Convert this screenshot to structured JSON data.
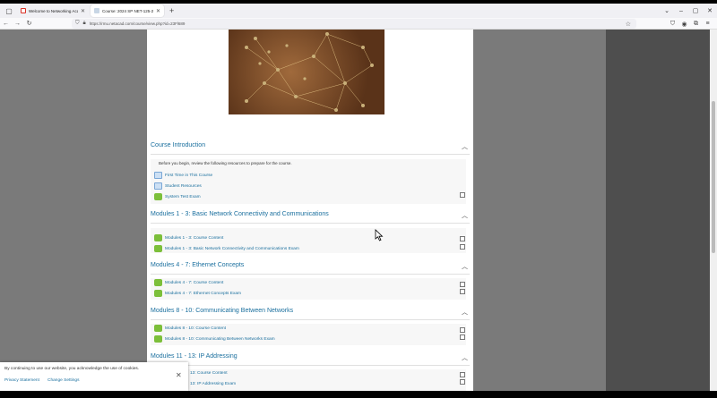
{
  "browser": {
    "tabs": [
      {
        "title": "Welcome to Networking Acade",
        "active": false,
        "favicon": "gmail-icon"
      },
      {
        "title": "Course: 2024 SP NET-125-201",
        "active": true,
        "favicon": "course-icon"
      }
    ],
    "url": "https://rmu.netacad.com/course/view.php?id=23Fl689"
  },
  "page": {
    "sections": [
      {
        "title": "Course Introduction",
        "intro": "Before you begin, review the following resources to prepare for the course.",
        "items": [
          {
            "label": "First Time in This Course",
            "icon": "file-icon"
          },
          {
            "label": "Student Resources",
            "icon": "file-icon"
          },
          {
            "label": "System Test Exam",
            "icon": "puzzle-icon"
          }
        ]
      },
      {
        "title": "Modules 1 - 3: Basic Network Connectivity and Communications",
        "items": [
          {
            "label": "Modules 1 - 3: Course Content",
            "icon": "puzzle-icon"
          },
          {
            "label": "Modules 1 - 3: Basic Network Connectivity and Communications Exam",
            "icon": "puzzle-icon"
          }
        ]
      },
      {
        "title": "Modules 4 - 7: Ethernet Concepts",
        "items": [
          {
            "label": "Modules 4 - 7: Course Content",
            "icon": "puzzle-icon"
          },
          {
            "label": "Modules 4 - 7: Ethernet Concepts Exam",
            "icon": "puzzle-icon"
          }
        ]
      },
      {
        "title": "Modules 8 - 10: Communicating Between Networks",
        "items": [
          {
            "label": "Modules 8 - 10: Course Content",
            "icon": "puzzle-icon"
          },
          {
            "label": "Modules 8 - 10: Communicating Between Networks Exam",
            "icon": "puzzle-icon"
          }
        ]
      },
      {
        "title": "Modules 11 - 13: IP Addressing",
        "items": [
          {
            "label": "13: Course Content",
            "icon": "puzzle-icon"
          },
          {
            "label": "13: IP Addressing Exam",
            "icon": "puzzle-icon"
          }
        ]
      }
    ]
  },
  "cookie_banner": {
    "text": "By continuing to use our website, you acknowledge the use of cookies.",
    "privacy_link": "Privacy Statement",
    "settings_link": "Change Settings"
  },
  "colors": {
    "link": "#1a6f9e",
    "side": "#7a7a7a"
  }
}
